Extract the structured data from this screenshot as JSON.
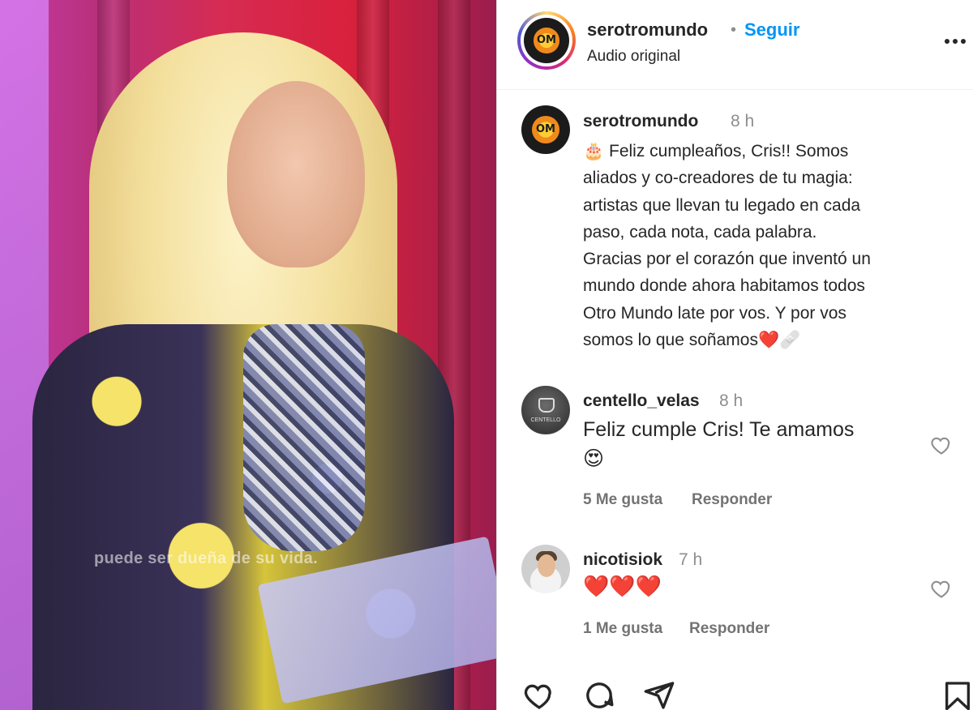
{
  "media": {
    "caption_overlay": "puede ser dueña de su vida."
  },
  "header": {
    "username": "serotromundo",
    "separator": "•",
    "follow_label": "Seguir",
    "subtitle": "Audio original",
    "more_label": "•••"
  },
  "post": {
    "username": "serotromundo",
    "time": "8 h",
    "text_emoji_start": "🎂",
    "text": " Feliz cumpleaños, Cris!! Somos\naliados y co-creadores de tu magia:\nartistas que llevan tu legado en cada\npaso, cada nota, cada palabra.\nGracias por el corazón que inventó un\nmundo donde ahora habitamos todos\nOtro Mundo late por vos. Y por vos\nsomos lo que soñamos",
    "text_emoji_end": "❤️🩹"
  },
  "comments": [
    {
      "username": "centello_velas",
      "time": "8 h",
      "text": "Feliz cumple Cris! Te amamos",
      "emoji": "😍",
      "likes": "5 Me gusta",
      "reply": "Responder"
    },
    {
      "username": "nicotisiok",
      "time": "7 h",
      "emoji": "❤️❤️❤️",
      "likes": "1 Me gusta",
      "reply": "Responder"
    }
  ],
  "avatar_labels": {
    "centello": "CENTELLO"
  },
  "logo_mark": "OM",
  "icons": [
    "heart-icon",
    "comment-icon",
    "share-icon",
    "bookmark-icon"
  ]
}
